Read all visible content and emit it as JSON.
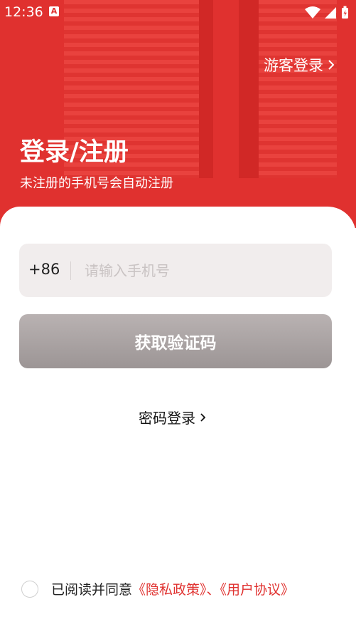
{
  "status_bar": {
    "time": "12:36",
    "app_badge": "A"
  },
  "header": {
    "guest_login": "游客登录",
    "title": "登录/注册",
    "subtitle": "未注册的手机号会自动注册"
  },
  "form": {
    "country_code": "+86",
    "phone_placeholder": "请输入手机号",
    "phone_value": "",
    "get_code_label": "获取验证码",
    "password_login": "密码登录"
  },
  "agreement": {
    "checked": false,
    "prefix": "已阅读并同意",
    "privacy": "《隐私政策》",
    "separator": "、",
    "user_agreement": "《用户协议》"
  },
  "colors": {
    "brand_red": "#e0312f",
    "button_gray": "#a8a1a1",
    "input_bg": "#f1eded"
  }
}
